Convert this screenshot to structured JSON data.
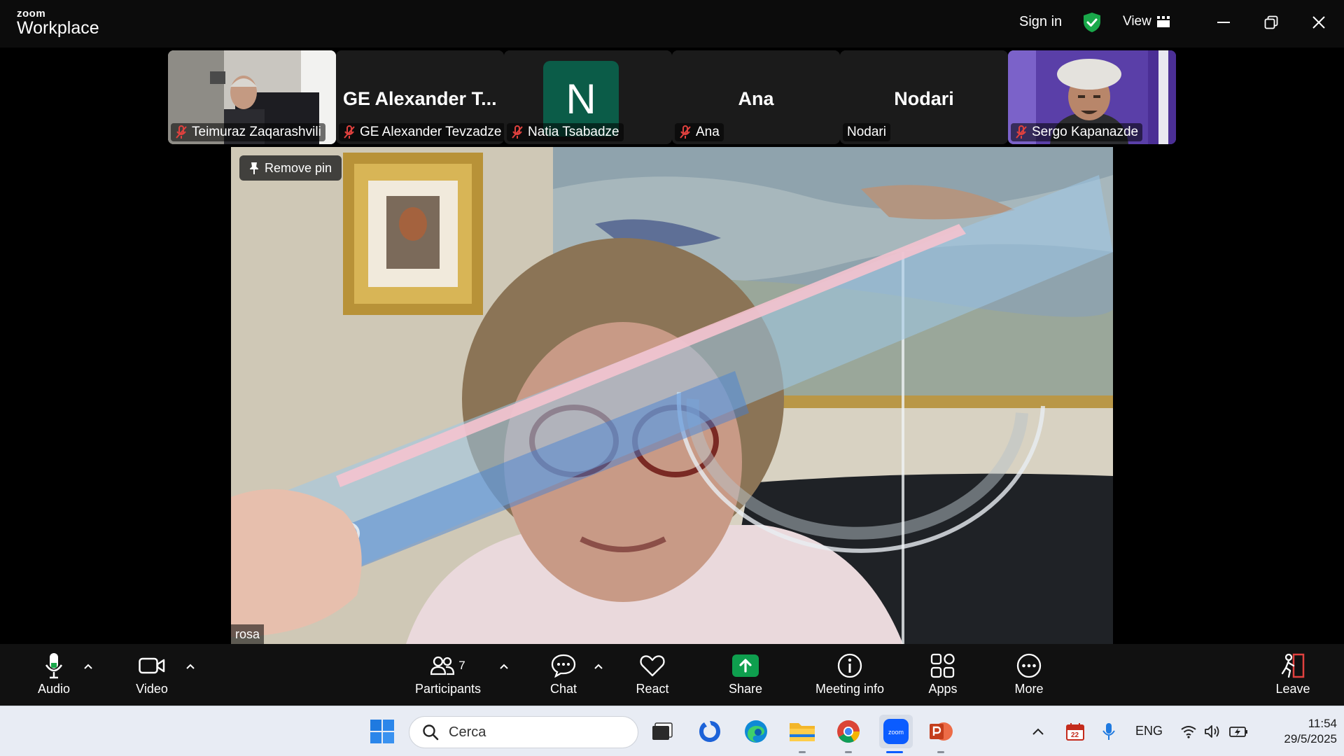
{
  "app": {
    "brand_small": "zoom",
    "brand_large": "Workplace",
    "sign_in": "Sign in",
    "view_label": "View"
  },
  "thumbnails": [
    {
      "name": "Teimuraz Zaqarashvili",
      "display": "video",
      "muted": true
    },
    {
      "name": "GE Alexander Tevzadze",
      "big_label": "GE Alexander T...",
      "display": "name",
      "muted": true
    },
    {
      "name": "Natia Tsabadze",
      "avatar_letter": "N",
      "display": "avatar",
      "muted": true
    },
    {
      "name": "Ana",
      "big_label": "Ana",
      "display": "name",
      "muted": true
    },
    {
      "name": "Nodari",
      "big_label": "Nodari",
      "display": "name",
      "muted": false
    },
    {
      "name": "Sergo Kapanazde",
      "display": "video",
      "muted": true
    }
  ],
  "main_video": {
    "pin_label": "Remove pin",
    "speaker": "rosa"
  },
  "toolbar": {
    "audio": "Audio",
    "video": "Video",
    "participants": "Participants",
    "participants_count": "7",
    "chat": "Chat",
    "react": "React",
    "share": "Share",
    "meeting_info": "Meeting info",
    "apps": "Apps",
    "more": "More",
    "leave": "Leave"
  },
  "taskbar": {
    "search_placeholder": "Cerca",
    "calendar_day": "22",
    "language": "ENG",
    "time": "11:54",
    "date": "29/5/2025"
  },
  "colors": {
    "share_green": "#0e9f4e",
    "shield_green": "#19a84a",
    "avatar_bg": "#0b5c48",
    "muted_red": "#e0413e",
    "zoom_blue": "#0b5cff"
  }
}
